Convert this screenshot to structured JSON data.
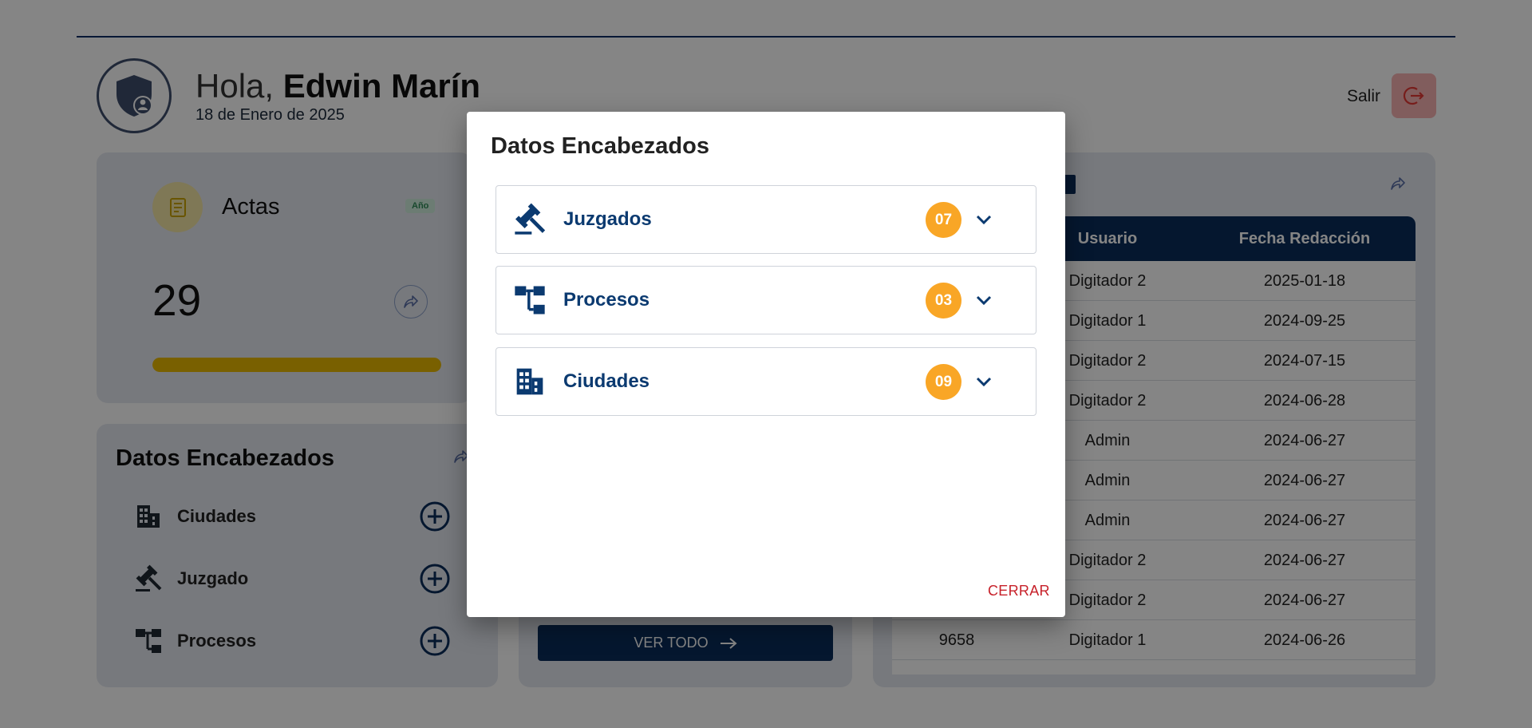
{
  "header": {
    "greeting": "Hola,",
    "user_name": "Edwin Marín",
    "date": "18 de Enero de 2025",
    "logout_label": "Salir"
  },
  "actas_card": {
    "title": "Actas",
    "badge": "Año",
    "count": "29",
    "progress_fraction": 1.0,
    "colors": {
      "accent": "#e8b800",
      "badge_text": "#2e8b57"
    }
  },
  "datos_card": {
    "title": "Datos Encabezados",
    "items": [
      {
        "label": "Ciudades",
        "icon": "buildings-icon"
      },
      {
        "label": "Juzgado",
        "icon": "gavel-icon"
      },
      {
        "label": "Procesos",
        "icon": "hierarchy-icon"
      }
    ]
  },
  "middle_card": {
    "button_label": "VER TODO"
  },
  "table": {
    "columns": [
      "Usuario",
      "Fecha Redacción"
    ],
    "rows": [
      {
        "id": "",
        "usuario": "Digitador 2",
        "fecha": "2025-01-18"
      },
      {
        "id": "",
        "usuario": "Digitador 1",
        "fecha": "2024-09-25"
      },
      {
        "id": "",
        "usuario": "Digitador 2",
        "fecha": "2024-07-15"
      },
      {
        "id": "",
        "usuario": "Digitador 2",
        "fecha": "2024-06-28"
      },
      {
        "id": "",
        "usuario": "Admin",
        "fecha": "2024-06-27"
      },
      {
        "id": "",
        "usuario": "Admin",
        "fecha": "2024-06-27"
      },
      {
        "id": "",
        "usuario": "Admin",
        "fecha": "2024-06-27"
      },
      {
        "id": "",
        "usuario": "Digitador 2",
        "fecha": "2024-06-27"
      },
      {
        "id": "",
        "usuario": "Digitador 2",
        "fecha": "2024-06-27"
      },
      {
        "id": "9658",
        "usuario": "Digitador 1",
        "fecha": "2024-06-26"
      }
    ]
  },
  "modal": {
    "title": "Datos Encabezados",
    "items": [
      {
        "label": "Juzgados",
        "count": "07",
        "icon": "gavel-icon"
      },
      {
        "label": "Procesos",
        "count": "03",
        "icon": "hierarchy-icon"
      },
      {
        "label": "Ciudades",
        "count": "09",
        "icon": "buildings-icon"
      }
    ],
    "close_label": "CERRAR",
    "colors": {
      "primary": "#0b3a70",
      "count_badge": "#f9a626",
      "close": "#c7212a"
    }
  }
}
